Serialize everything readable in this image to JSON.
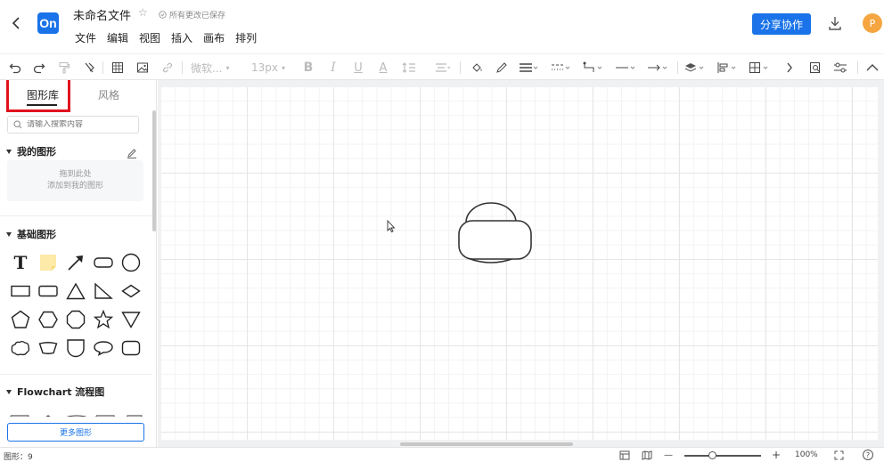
{
  "header": {
    "back_label": "<",
    "logo_text": "On",
    "file_title": "未命名文件",
    "saved_status": "所有更改已保存",
    "menu": [
      "文件",
      "编辑",
      "视图",
      "插入",
      "画布",
      "排列"
    ],
    "share_label": "分享协作",
    "avatar_letter": "P"
  },
  "toolbar": {
    "font_name": "微软...",
    "font_size": "13px",
    "bold": "B",
    "italic": "I",
    "underline": "U",
    "font_color": "A"
  },
  "sidebar": {
    "tabs": [
      "图形库",
      "风格"
    ],
    "search_placeholder": "请输入搜索内容",
    "my_shapes_title": "我的图形",
    "dropzone_line1": "拖到此处",
    "dropzone_line2": "添加到我的图形",
    "basic_shapes_title": "基础图形",
    "text_shape_label": "T",
    "flowchart_title": "Flowchart 流程图",
    "more_shapes_label": "更多图形"
  },
  "status": {
    "shape_count": "图形：9",
    "zoom": "100%",
    "minus": "—",
    "plus": "+",
    "help": "?"
  },
  "colors": {
    "accent": "#1a73e8",
    "highlight": "#e0121e",
    "avatar": "#f5a640"
  }
}
